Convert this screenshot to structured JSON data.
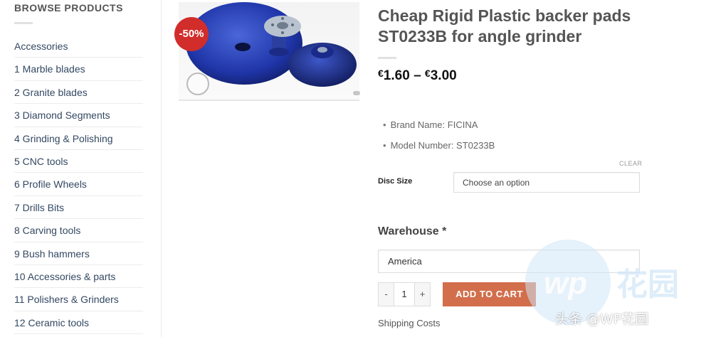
{
  "sidebar": {
    "title": "BROWSE PRODUCTS",
    "categories": [
      "Accessories",
      "1 Marble blades",
      "2 Granite blades",
      "3 Diamond Segments",
      "4 Grinding & Polishing",
      "5 CNC tools",
      "6 Profile Wheels",
      "7 Drills Bits",
      "8 Carving tools",
      "9 Bush hammers",
      "10 Accessories & parts",
      "11 Polishers & Grinders",
      "12 Ceramic tools"
    ]
  },
  "product": {
    "sale_badge": "-50%",
    "title": "Cheap Rigid Plastic backer pads ST0233B for angle grinder",
    "price": {
      "currency_symbol": "€",
      "min": "1.60",
      "separator": "–",
      "max": "3.00"
    },
    "attributes": [
      "Brand Name: FICINA",
      "Model Number: ST0233B"
    ],
    "clear_label": "CLEAR",
    "disc_size_label": "Disc Size",
    "disc_size_value": "Choose an option",
    "warehouse_label": "Warehouse *",
    "warehouse_value": "America",
    "quantity": {
      "minus": "-",
      "value": "1",
      "plus": "+"
    },
    "add_to_cart": "ADD TO CART",
    "shipping_label": "Shipping Costs"
  },
  "watermark": {
    "text": "头条 @WP花园",
    "logo_text": "花园"
  },
  "colors": {
    "sale_badge": "#d12d2b",
    "add_to_cart": "#d26e4b",
    "category_link": "#334862"
  }
}
